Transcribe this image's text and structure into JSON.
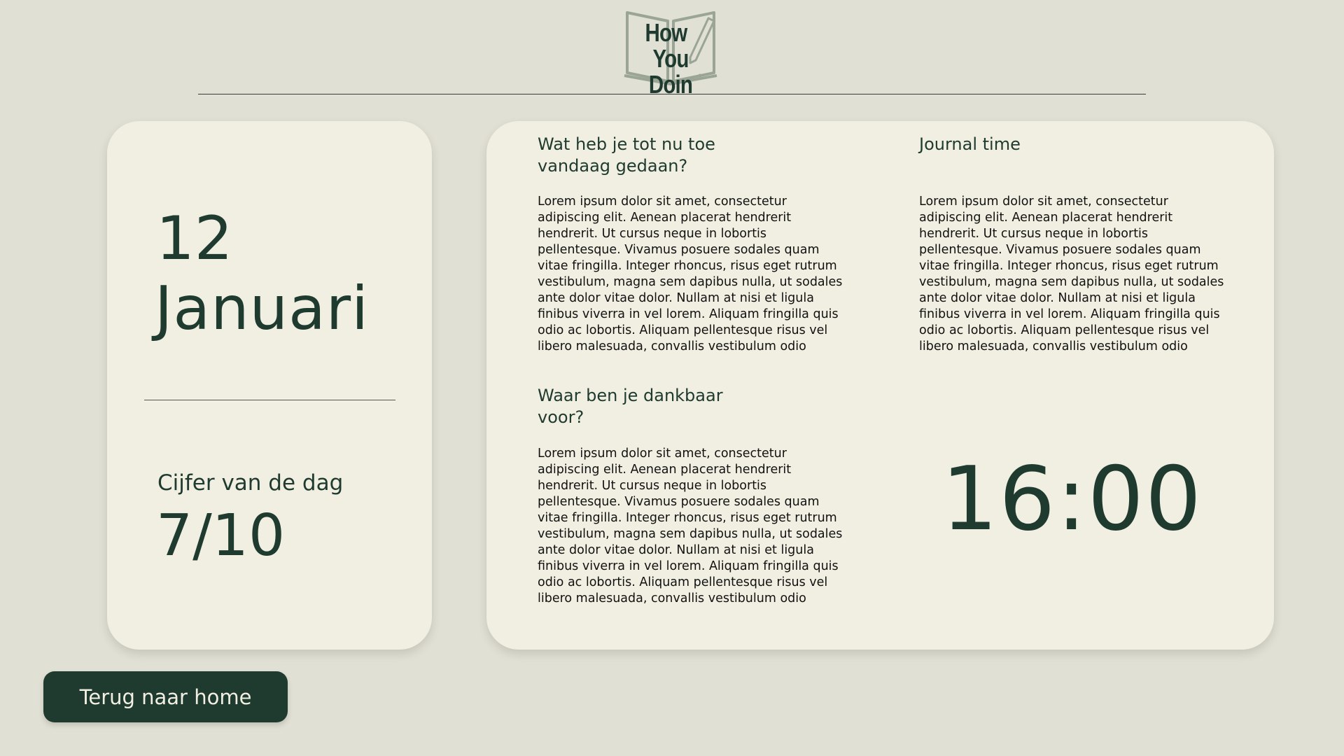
{
  "header": {
    "logo": {
      "line1_word1": "How",
      "line1_word2": "You",
      "line2": "Doin",
      "icon": "open-book-icon"
    }
  },
  "date_card": {
    "day": "12",
    "month": "Januari",
    "score_label": "Cijfer van de dag",
    "score_value": "7/10"
  },
  "entries": {
    "done_today": {
      "title": "Wat heb je tot nu toe vandaag gedaan?",
      "body": "Lorem ipsum dolor sit amet, consectetur adipiscing elit. Aenean placerat hendrerit hendrerit. Ut cursus neque in lobortis pellentesque. Vivamus posuere sodales quam vitae fringilla. Integer rhoncus, risus eget rutrum vestibulum, magna sem dapibus nulla, ut sodales ante dolor vitae dolor. Nullam at nisi et ligula finibus viverra in vel lorem. Aliquam fringilla quis odio ac lobortis. Aliquam pellentesque risus vel libero malesuada, convallis vestibulum odio"
    },
    "journal": {
      "title": "Journal time",
      "body": "Lorem ipsum dolor sit amet, consectetur adipiscing elit. Aenean placerat hendrerit hendrerit. Ut cursus neque in lobortis pellentesque. Vivamus posuere sodales quam vitae fringilla. Integer rhoncus, risus eget rutrum vestibulum, magna sem dapibus nulla, ut sodales ante dolor vitae dolor. Nullam at nisi et ligula finibus viverra in vel lorem. Aliquam fringilla quis odio ac lobortis. Aliquam pellentesque risus vel libero malesuada, convallis vestibulum odio"
    },
    "grateful": {
      "title": "Waar ben je dankbaar voor?",
      "body": "Lorem ipsum dolor sit amet, consectetur adipiscing elit. Aenean placerat hendrerit hendrerit. Ut cursus neque in lobortis pellentesque. Vivamus posuere sodales quam vitae fringilla. Integer rhoncus, risus eget rutrum vestibulum, magna sem dapibus nulla, ut sodales ante dolor vitae dolor. Nullam at nisi et ligula finibus viverra in vel lorem. Aliquam fringilla quis odio ac lobortis. Aliquam pellentesque risus vel libero malesuada, convallis vestibulum odio"
    }
  },
  "clock": {
    "time": "16:00"
  },
  "nav": {
    "home_button_label": "Terug naar home"
  },
  "colors": {
    "background": "#e0e0d4",
    "card": "#f0efe1",
    "accent": "#1f3a2f",
    "logo_outline": "#9aa596"
  }
}
